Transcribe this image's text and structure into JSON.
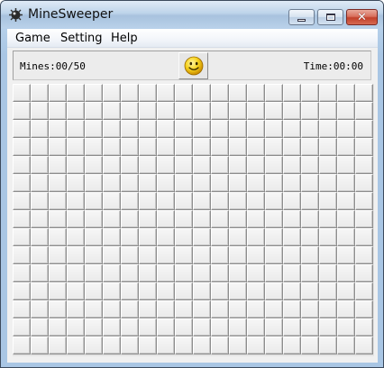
{
  "window": {
    "title": "MineSweeper",
    "icon": "mine-icon",
    "controls": {
      "minimize": "minimize-icon",
      "maximize": "maximize-icon",
      "close": "close-icon"
    }
  },
  "menu": {
    "items": [
      {
        "label": "Game"
      },
      {
        "label": "Setting"
      },
      {
        "label": "Help"
      }
    ]
  },
  "status": {
    "mines_label": "Mines:00/50",
    "time_label": "Time:00:00",
    "face_icon": "smiley-face-icon"
  },
  "board": {
    "columns": 20,
    "rows": 15,
    "cell_state": "covered"
  },
  "colors": {
    "title_bar": "#b9d1e9",
    "close_button": "#c2402a",
    "cell_face": "#eeeeee",
    "smiley_yellow": "#f6d21c"
  }
}
